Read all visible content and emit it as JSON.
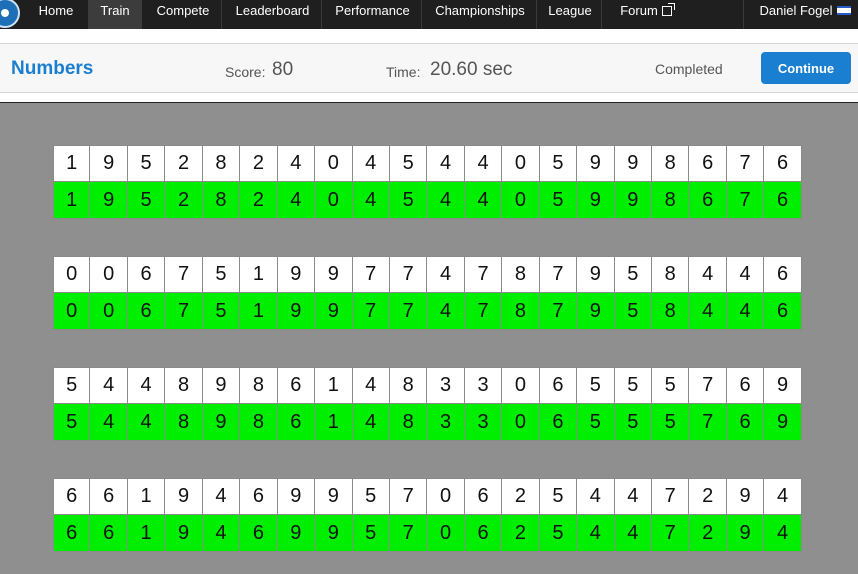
{
  "nav": {
    "items": [
      "Home",
      "Train",
      "Compete",
      "Leaderboard",
      "Performance",
      "Championships",
      "League",
      "Forum"
    ],
    "active": "Train",
    "user": "Daniel Fogel"
  },
  "header": {
    "title": "Numbers",
    "score_label": "Score:",
    "score_value": "80",
    "time_label": "Time:",
    "time_value": "20.60 sec",
    "status": "Completed",
    "continue_label": "Continue"
  },
  "colors": {
    "accent": "#1a7fd0",
    "correct": "#00ee00",
    "nav_bg": "#1f1f1f"
  },
  "rows": [
    {
      "target": [
        "1",
        "9",
        "5",
        "2",
        "8",
        "2",
        "4",
        "0",
        "4",
        "5",
        "4",
        "4",
        "0",
        "5",
        "9",
        "9",
        "8",
        "6",
        "7",
        "6"
      ],
      "answer": [
        "1",
        "9",
        "5",
        "2",
        "8",
        "2",
        "4",
        "0",
        "4",
        "5",
        "4",
        "4",
        "0",
        "5",
        "9",
        "9",
        "8",
        "6",
        "7",
        "6"
      ]
    },
    {
      "target": [
        "0",
        "0",
        "6",
        "7",
        "5",
        "1",
        "9",
        "9",
        "7",
        "7",
        "4",
        "7",
        "8",
        "7",
        "9",
        "5",
        "8",
        "4",
        "4",
        "6"
      ],
      "answer": [
        "0",
        "0",
        "6",
        "7",
        "5",
        "1",
        "9",
        "9",
        "7",
        "7",
        "4",
        "7",
        "8",
        "7",
        "9",
        "5",
        "8",
        "4",
        "4",
        "6"
      ]
    },
    {
      "target": [
        "5",
        "4",
        "4",
        "8",
        "9",
        "8",
        "6",
        "1",
        "4",
        "8",
        "3",
        "3",
        "0",
        "6",
        "5",
        "5",
        "5",
        "7",
        "6",
        "9"
      ],
      "answer": [
        "5",
        "4",
        "4",
        "8",
        "9",
        "8",
        "6",
        "1",
        "4",
        "8",
        "3",
        "3",
        "0",
        "6",
        "5",
        "5",
        "5",
        "7",
        "6",
        "9"
      ]
    },
    {
      "target": [
        "6",
        "6",
        "1",
        "9",
        "4",
        "6",
        "9",
        "9",
        "5",
        "7",
        "0",
        "6",
        "2",
        "5",
        "4",
        "4",
        "7",
        "2",
        "9",
        "4"
      ],
      "answer": [
        "6",
        "6",
        "1",
        "9",
        "4",
        "6",
        "9",
        "9",
        "5",
        "7",
        "0",
        "6",
        "2",
        "5",
        "4",
        "4",
        "7",
        "2",
        "9",
        "4"
      ]
    }
  ]
}
